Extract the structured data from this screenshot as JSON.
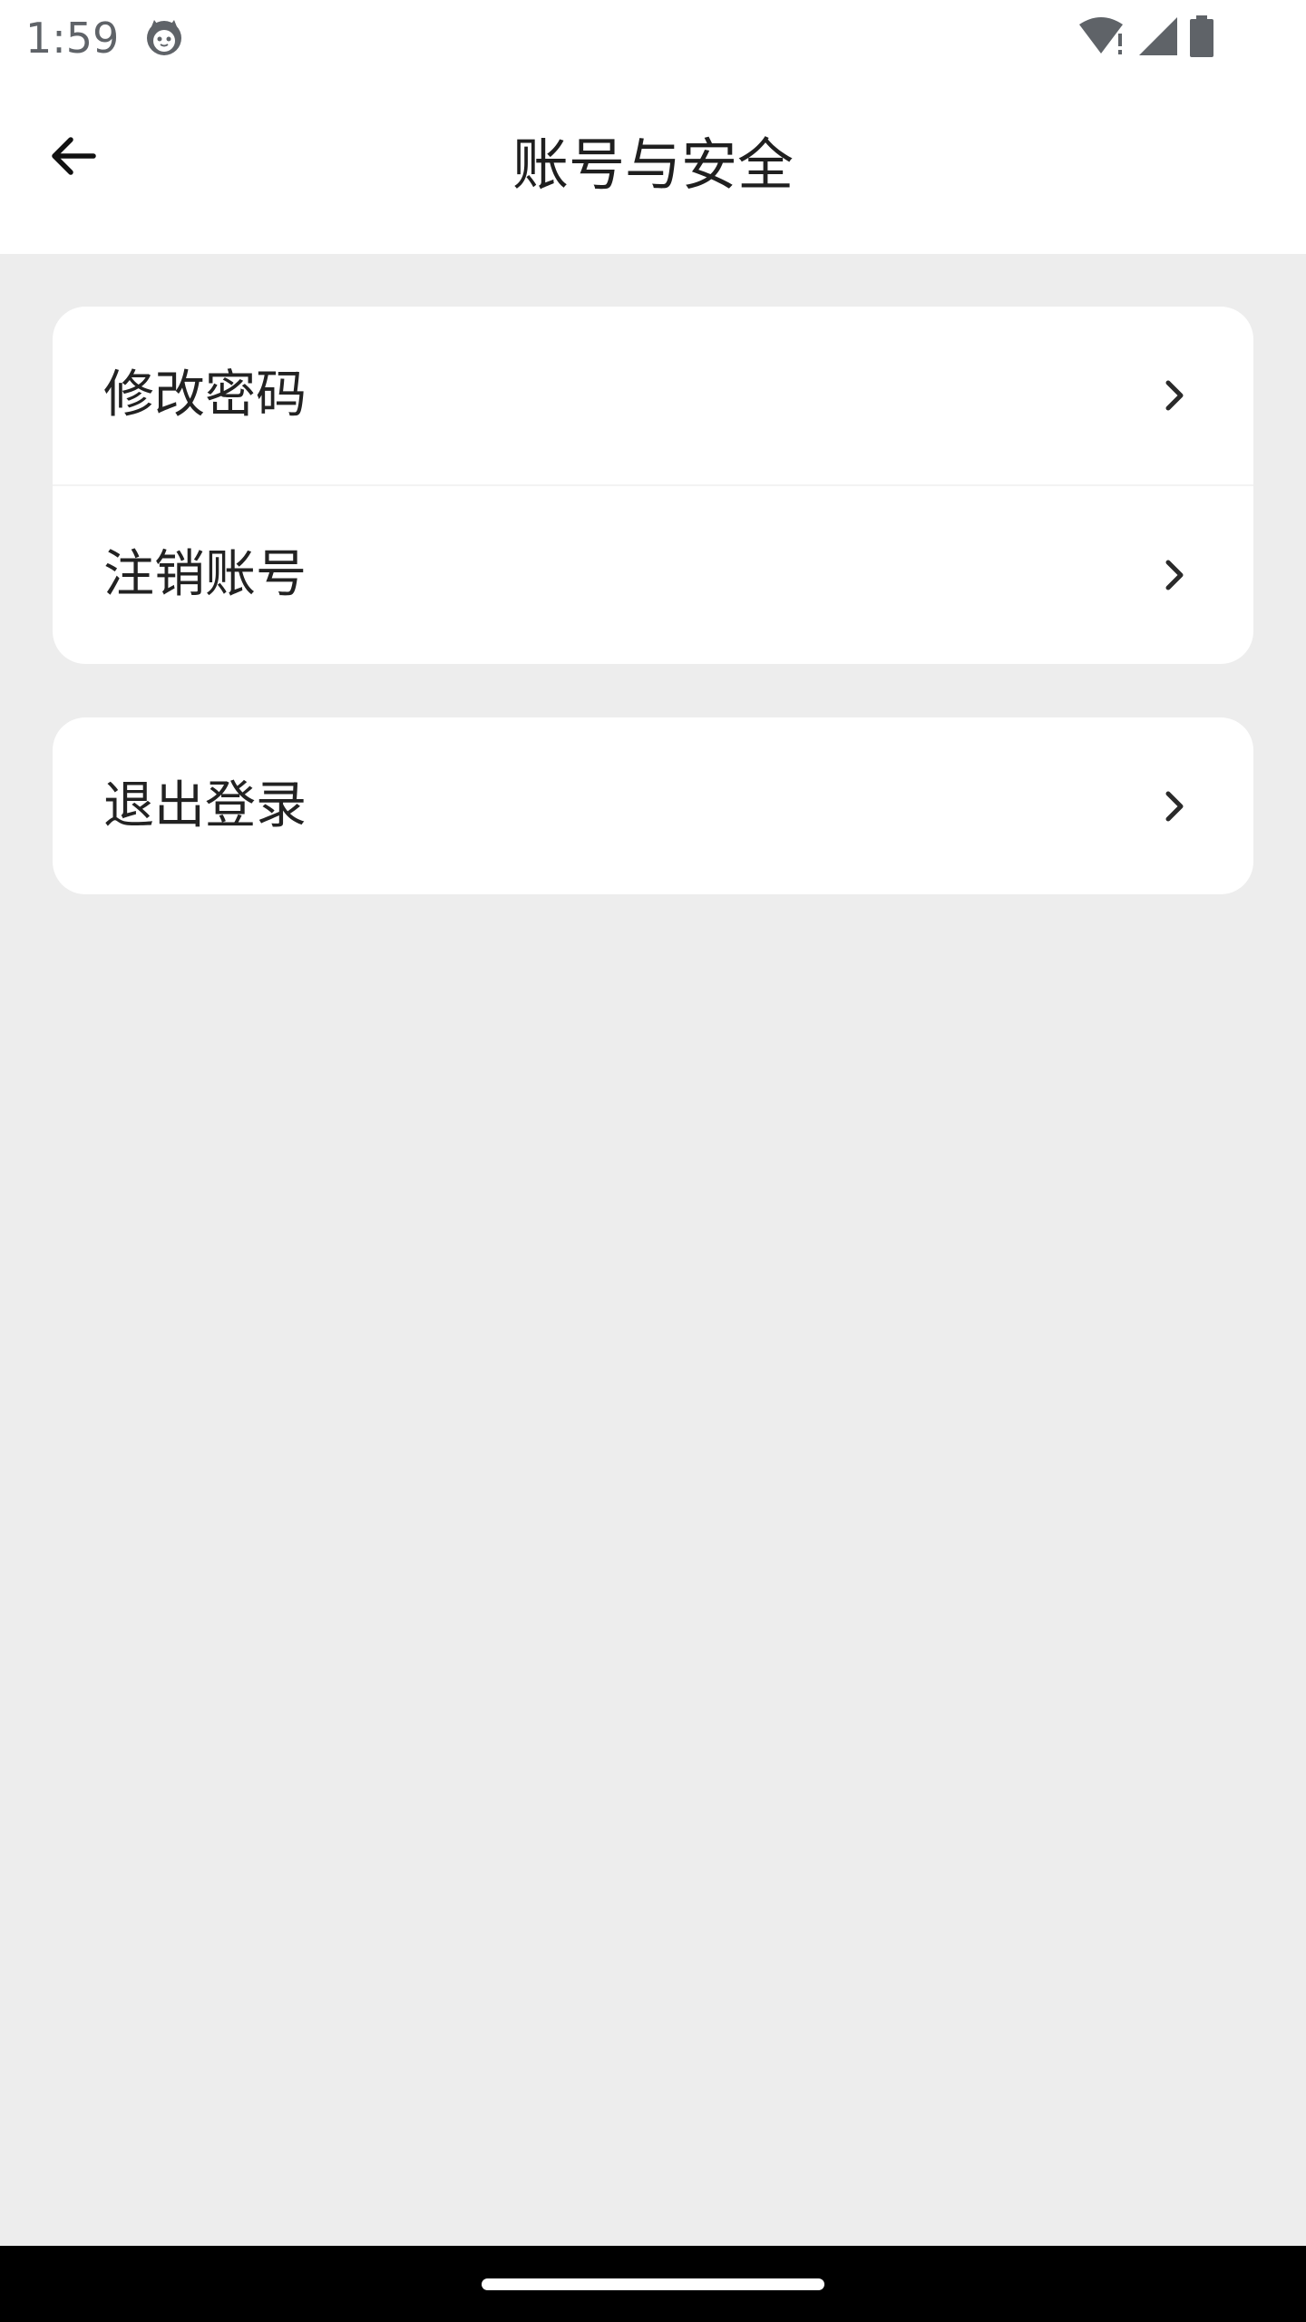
{
  "status_bar": {
    "time": "1:59",
    "app_icon": "cat-face-icon",
    "wifi_icon": "wifi-alert-icon",
    "signal_icon": "cell-signal-icon",
    "battery_icon": "battery-icon"
  },
  "header": {
    "back_icon": "arrow-left-icon",
    "title": "账号与安全"
  },
  "sections": [
    {
      "items": [
        {
          "label": "修改密码",
          "icon": "chevron-right-icon"
        },
        {
          "label": "注销账号",
          "icon": "chevron-right-icon"
        }
      ]
    },
    {
      "items": [
        {
          "label": "退出登录",
          "icon": "chevron-right-icon"
        }
      ]
    }
  ],
  "colors": {
    "background": "#ededed",
    "surface": "#ffffff",
    "text": "#1f1f1f",
    "status_text": "#5f6368",
    "nav_bar": "#000000"
  }
}
